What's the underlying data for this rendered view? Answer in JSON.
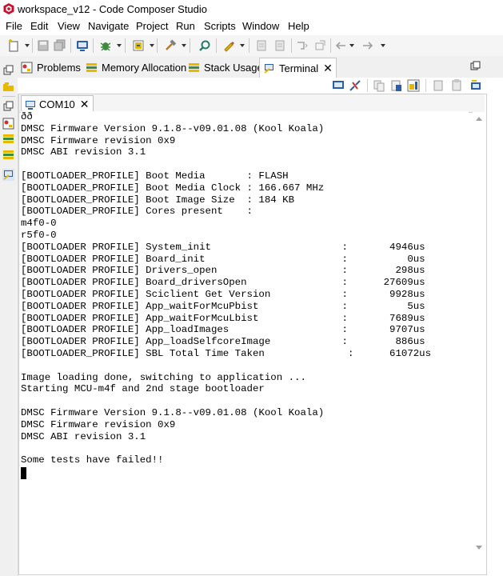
{
  "window": {
    "title": "workspace_v12 - Code Composer Studio"
  },
  "menu": {
    "items": [
      "File",
      "Edit",
      "View",
      "Navigate",
      "Project",
      "Run",
      "Scripts",
      "Window",
      "Help"
    ]
  },
  "views": {
    "tabs": [
      {
        "label": "Problems",
        "icon": "problems-icon"
      },
      {
        "label": "Memory Allocation",
        "icon": "memory-allocation-icon"
      },
      {
        "label": "Stack Usage",
        "icon": "stack-usage-icon"
      },
      {
        "label": "Terminal",
        "icon": "terminal-icon",
        "active": true
      }
    ],
    "close_glyph": "✕"
  },
  "terminal": {
    "tab_label": "COM10",
    "close_glyph": "✕",
    "lines": [
      "ðð",
      "DMSC Firmware Version 9.1.8--v09.01.08 (Kool Koala)",
      "DMSC Firmware revision 0x9",
      "DMSC ABI revision 3.1",
      "",
      "[BOOTLOADER_PROFILE] Boot Media       : FLASH",
      "[BOOTLOADER_PROFILE] Boot Media Clock : 166.667 MHz",
      "[BOOTLOADER_PROFILE] Boot Image Size  : 184 KB",
      "[BOOTLOADER_PROFILE] Cores present    :",
      "m4f0-0",
      "r5f0-0",
      "[BOOTLOADER PROFILE] System_init                      :       4946us",
      "[BOOTLOADER PROFILE] Board_init                       :          0us",
      "[BOOTLOADER PROFILE] Drivers_open                     :        298us",
      "[BOOTLOADER PROFILE] Board_driversOpen                :      27609us",
      "[BOOTLOADER PROFILE] Sciclient Get Version            :       9928us",
      "[BOOTLOADER PROFILE] App_waitForMcuPbist              :          5us",
      "[BOOTLOADER PROFILE] App_waitForMcuLbist              :       7689us",
      "[BOOTLOADER PROFILE] App_loadImages                   :       9707us",
      "[BOOTLOADER PROFILE] App_loadSelfcoreImage            :        886us",
      "[BOOTLOADER_PROFILE] SBL Total Time Taken              :      61072us",
      "",
      "Image loading done, switching to application ...",
      "Starting MCU-m4f and 2nd stage bootloader",
      "",
      "DMSC Firmware Version 9.1.8--v09.01.08 (Kool Koala)",
      "DMSC Firmware revision 0x9",
      "DMSC ABI revision 3.1",
      "",
      "Some tests have failed!!"
    ]
  },
  "colors": {
    "logo_red": "#c8102e",
    "toolbar_bg": "#f5f5f5",
    "trim_bg": "#f0f0f0",
    "icon_blue": "#2a5ea8",
    "icon_yellow": "#e6b800"
  }
}
